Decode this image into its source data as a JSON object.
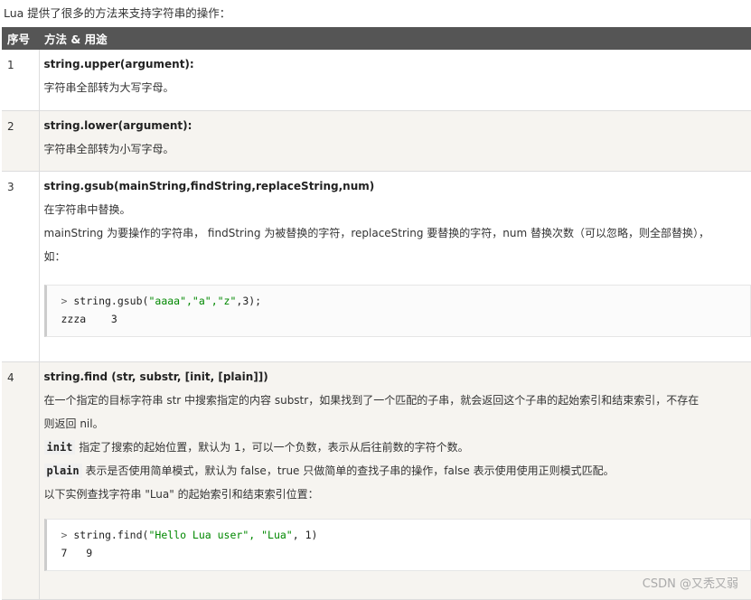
{
  "intro": "Lua 提供了很多的方法来支持字符串的操作：",
  "headers": {
    "num": "序号",
    "method": "方法 & 用途"
  },
  "rows": [
    {
      "num": "1",
      "name": "string.upper(argument):",
      "desc": "字符串全部转为大写字母。"
    },
    {
      "num": "2",
      "name": "string.lower(argument):",
      "desc": "字符串全部转为小写字母。"
    },
    {
      "num": "3",
      "name": "string.gsub(mainString,findString,replaceString,num)",
      "desc": "在字符串中替换。",
      "desc2": "mainString 为要操作的字符串， findString 为被替换的字符，replaceString 要替换的字符，num 替换次数（可以忽略，则全部替换），",
      "desc3": "如：",
      "code": {
        "prompt": ">",
        "fn": "string.gsub(",
        "args": "\"aaaa\",\"a\",\"z\"",
        "tail": ",3);",
        "out": "zzza    3"
      }
    },
    {
      "num": "4",
      "name": "string.find (str, substr, [init, [plain]])",
      "desc": "在一个指定的目标字符串 str 中搜索指定的内容 substr，如果找到了一个匹配的子串，就会返回这个子串的起始索引和结束索引，不存在",
      "desc2": "则返回 nil。",
      "init_kw": "init",
      "init_desc": "指定了搜索的起始位置，默认为 1，可以一个负数，表示从后往前数的字符个数。",
      "plain_kw": "plain",
      "plain_desc": "表示是否使用简单模式，默认为 false，true 只做简单的查找子串的操作，false 表示使用使用正则模式匹配。",
      "example": "以下实例查找字符串 \"Lua\" 的起始索引和结束索引位置：",
      "code": {
        "prompt": ">",
        "fn": "string.find(",
        "args": "\"Hello Lua user\", \"Lua\"",
        "tail": ", 1)",
        "out": "7   9"
      }
    }
  ],
  "watermark": "CSDN @又秃又弱"
}
